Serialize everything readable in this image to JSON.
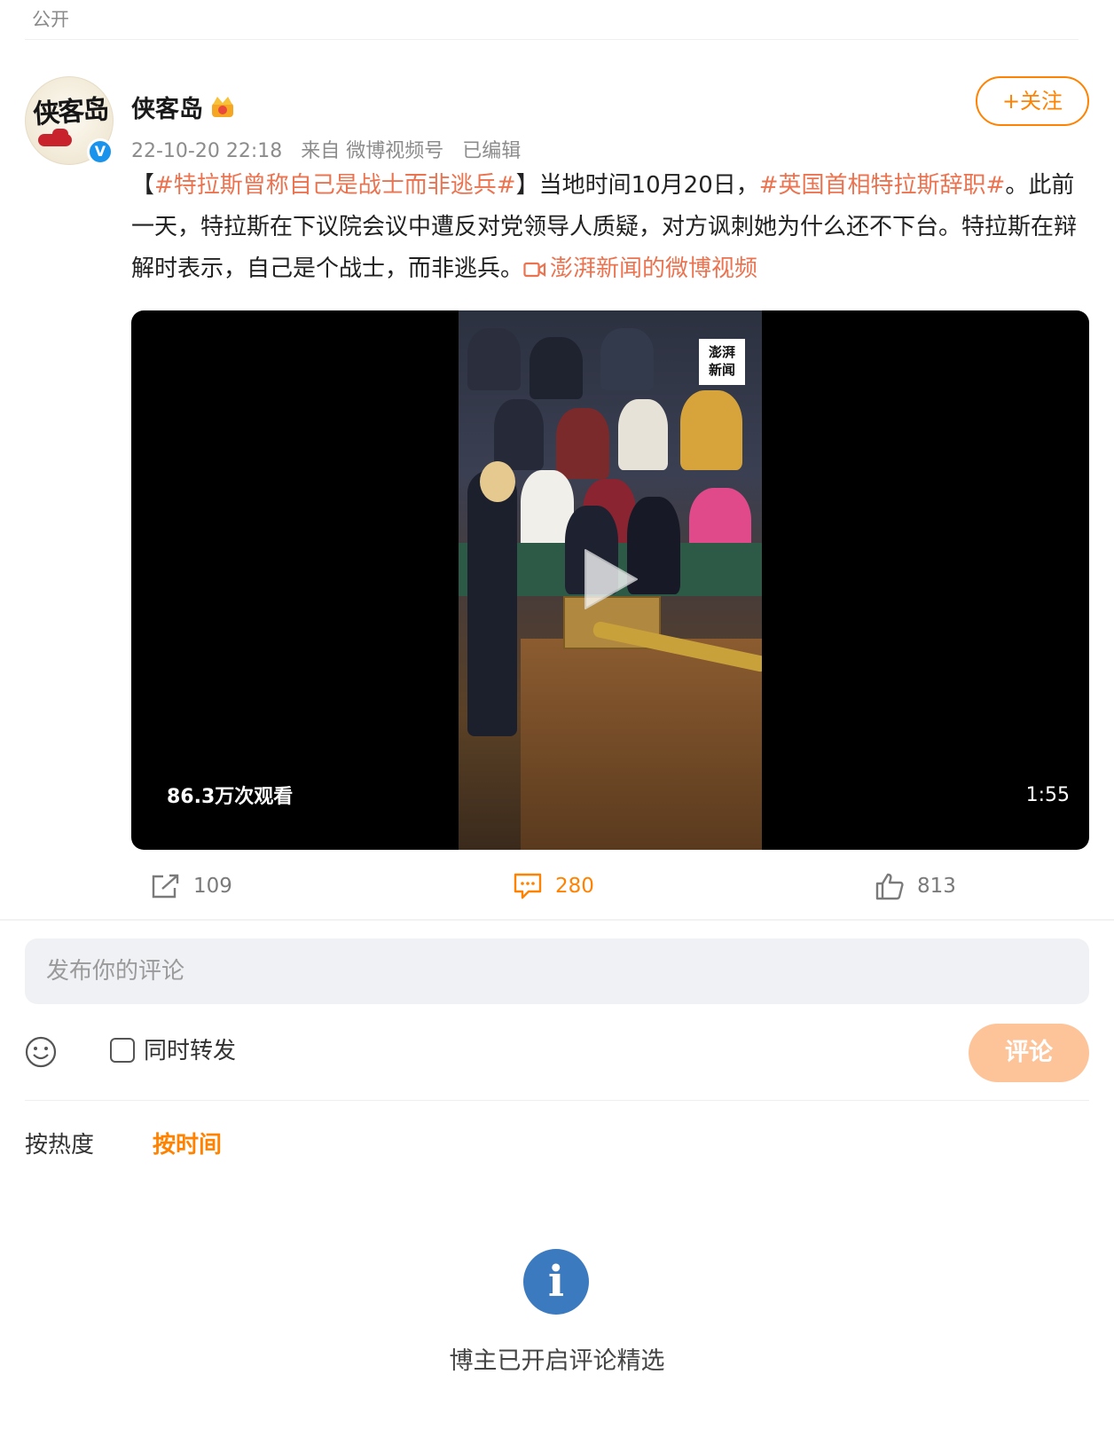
{
  "header": {
    "visibility": "公开"
  },
  "author": {
    "avatar_text": "侠客岛",
    "name": "侠客岛",
    "verified_mark": "V",
    "timestamp": "22-10-20 22:18",
    "source": "来自 微博视频号",
    "edited": "已编辑",
    "follow_label": "+关注"
  },
  "post": {
    "bracket_open": "【",
    "tag1": "#特拉斯曾称自己是战士而非逃兵#",
    "text1": "】当地时间10月20日，",
    "tag2": "#英国首相特拉斯辞职#",
    "text2": "。此前一天，特拉斯在下议院会议中遭反对党领导人质疑，对方讽刺她为什么还不下台。特拉斯在辩解时表示，自己是个战士，而非逃兵。",
    "source_link": "澎湃新闻的微博视频"
  },
  "video": {
    "watermark_line1": "澎湃",
    "watermark_line2": "新闻",
    "views": "86.3万次观看",
    "duration": "1:55"
  },
  "actions": {
    "repost_count": "109",
    "comment_count": "280",
    "like_count": "813"
  },
  "comment_box": {
    "placeholder": "发布你的评论",
    "repost_label": "同时转发",
    "submit_label": "评论"
  },
  "sort": {
    "hot": "按热度",
    "time": "按时间"
  },
  "notice": {
    "icon_glyph": "i",
    "text": "博主已开启评论精选"
  },
  "colors": {
    "accent": "#ff8200",
    "tag": "#eb7350",
    "verified": "#1a93ec",
    "info": "#3c7ac0"
  }
}
